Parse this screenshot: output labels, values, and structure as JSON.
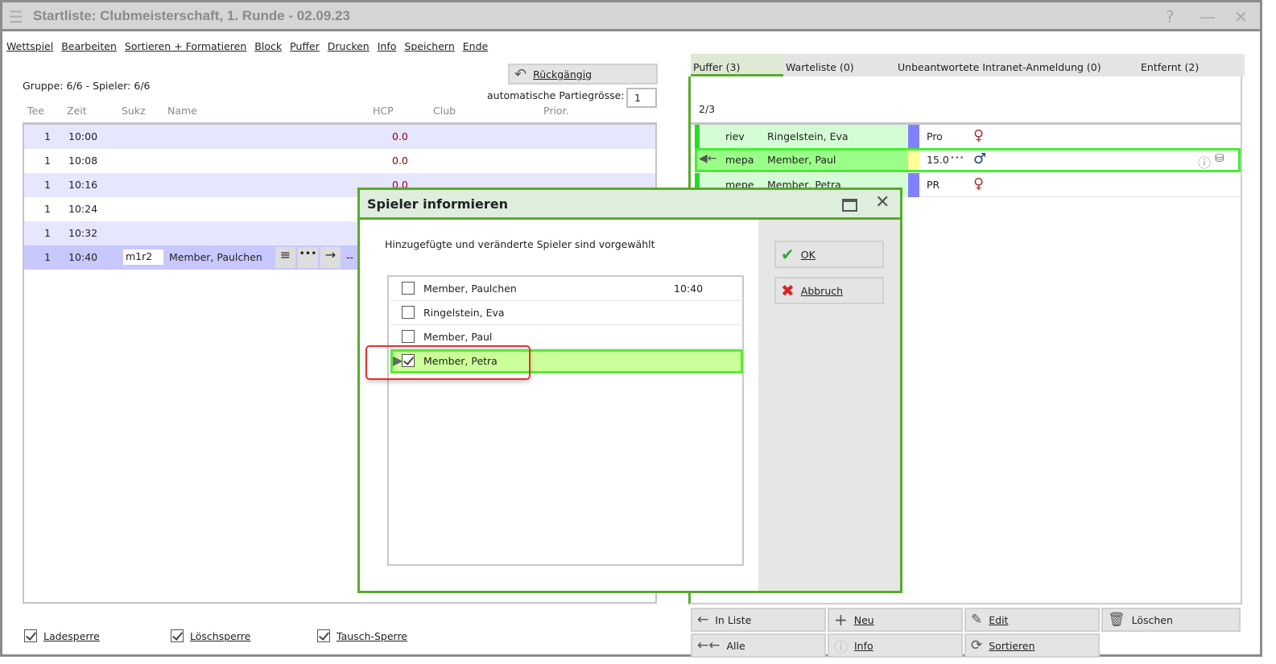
{
  "window": {
    "title": "Startliste: Clubmeisterschaft, 1. Runde - 02.09.23"
  },
  "menu": [
    "Wettspiel",
    "Bearbeiten",
    "Sortieren + Formatieren",
    "Block",
    "Puffer",
    "Drucken",
    "Info",
    "Speichern",
    "Ende"
  ],
  "left": {
    "group_info": "Gruppe: 6/6 - Spieler: 6/6",
    "undo_label": "Rückgängig",
    "auto_size_label": "automatische Partiegrösse:",
    "auto_size_value": "1",
    "columns": [
      "Tee",
      "Zeit",
      "Sukz",
      "Name",
      "HCP",
      "Club",
      "Prior."
    ],
    "rows": [
      {
        "tee": "1",
        "time": "10:00",
        "hcp": "0.0"
      },
      {
        "tee": "1",
        "time": "10:08",
        "hcp": "0.0"
      },
      {
        "tee": "1",
        "time": "10:16",
        "hcp": "0.0"
      },
      {
        "tee": "1",
        "time": "10:24"
      },
      {
        "tee": "1",
        "time": "10:32"
      },
      {
        "tee": "1",
        "time": "10:40",
        "sukz": "m1r2",
        "name": "Member, Paulchen",
        "extra": "--"
      }
    ],
    "checkboxes": [
      {
        "label": "Ladesperre",
        "checked": true
      },
      {
        "label": "Löschsperre",
        "checked": true
      },
      {
        "label": "Tausch-Sperre",
        "checked": true
      }
    ]
  },
  "right": {
    "tabs": [
      "Puffer (3)",
      "Warteliste (0)",
      "Unbeantwortete Intranet-Anmeldung (0)",
      "Entfernt (2)"
    ],
    "count": "2/3",
    "rows": [
      {
        "code": "riev",
        "name": "Ringelstein, Eva",
        "info": "Pro"
      },
      {
        "code": "mepa",
        "name": "Member, Paul",
        "info": "15.0"
      },
      {
        "code": "mepe",
        "name": "Member, Petra",
        "info": "PR"
      }
    ],
    "buttons": [
      "In Liste",
      "Neu",
      "Edit",
      "Löschen",
      "Alle",
      "Info",
      "Sortieren"
    ]
  },
  "dialog": {
    "title": "Spieler informieren",
    "message": "Hinzugefügte und veränderte Spieler sind vorgewählt",
    "items": [
      {
        "name": "Member, Paulchen",
        "time": "10:40",
        "checked": false
      },
      {
        "name": "Ringelstein, Eva",
        "checked": false
      },
      {
        "name": "Member, Paul",
        "checked": false
      },
      {
        "name": "Member, Petra",
        "checked": true
      }
    ],
    "ok_label": "OK",
    "cancel_label": "Abbruch"
  }
}
